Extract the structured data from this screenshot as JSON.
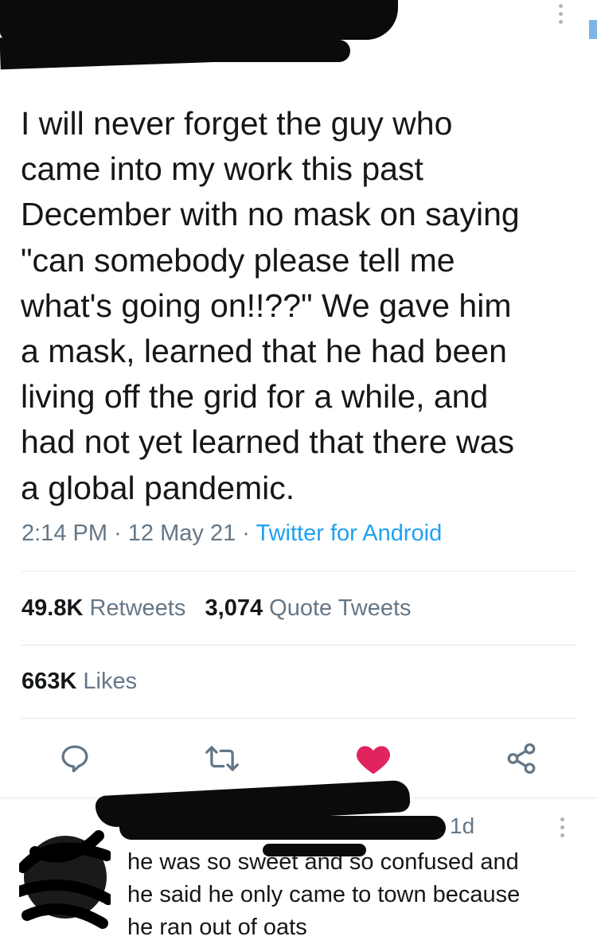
{
  "tweet": {
    "text": "I will never forget the guy who\ncame into my work this past\nDecember with no mask on saying\n\"can somebody please tell me\nwhat's going on!!??\" We gave him\na mask, learned that he had been\nliving off the grid for a while, and\nhad not yet learned that there was\na global pandemic.",
    "time": "2:14 PM",
    "date": "12 May 21",
    "separator": "·",
    "source": "Twitter for Android"
  },
  "stats": {
    "retweets_count": "49.8K",
    "retweets_label": "Retweets",
    "quotes_count": "3,074",
    "quotes_label": "Quote Tweets",
    "likes_count": "663K",
    "likes_label": "Likes"
  },
  "actions": {
    "reply_icon": "reply-icon",
    "retweet_icon": "retweet-icon",
    "like_icon": "heart-icon",
    "share_icon": "share-icon",
    "liked": true,
    "like_color": "#e0245e",
    "icon_color": "#657786"
  },
  "reply": {
    "age": "1d",
    "text": "he was so sweet and so confused and\nhe said he only came to town because\nhe ran out of oats"
  },
  "colors": {
    "link": "#1da1f2",
    "secondary_text": "#657786",
    "divider": "#e1e8ed"
  }
}
